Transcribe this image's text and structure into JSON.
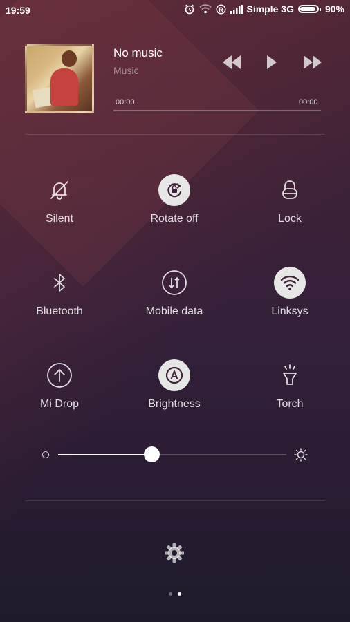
{
  "status_bar": {
    "time": "19:59",
    "carrier": "Simple 3G",
    "battery": "90%",
    "battery_level": 0.9,
    "icons": [
      "alarm-icon",
      "wifi-icon",
      "roaming-icon",
      "signal-icon",
      "battery-icon"
    ]
  },
  "music": {
    "title": "No music",
    "subtitle": "Music",
    "time_start": "00:00",
    "time_end": "00:00",
    "controls": [
      "previous-icon",
      "play-icon",
      "next-icon"
    ]
  },
  "toggles": [
    {
      "label": "Silent",
      "icon": "silent-bell-icon",
      "active": false
    },
    {
      "label": "Rotate off",
      "icon": "rotate-lock-icon",
      "active": true
    },
    {
      "label": "Lock",
      "icon": "lock-icon",
      "active": false
    },
    {
      "label": "Bluetooth",
      "icon": "bluetooth-icon",
      "active": false
    },
    {
      "label": "Mobile data",
      "icon": "mobile-data-icon",
      "active": false
    },
    {
      "label": "Linksys",
      "icon": "wifi-icon",
      "active": true
    },
    {
      "label": "Mi Drop",
      "icon": "mi-drop-icon",
      "active": false
    },
    {
      "label": "Brightness",
      "icon": "auto-brightness-icon",
      "active": true
    },
    {
      "label": "Torch",
      "icon": "torch-icon",
      "active": false
    }
  ],
  "brightness": {
    "level": 0.41
  },
  "pager": {
    "count": 2,
    "current": 1
  },
  "colors": {
    "accent": "#ffffff",
    "active_circle": "#e6e6e6",
    "active_icon": "#3f2237"
  }
}
